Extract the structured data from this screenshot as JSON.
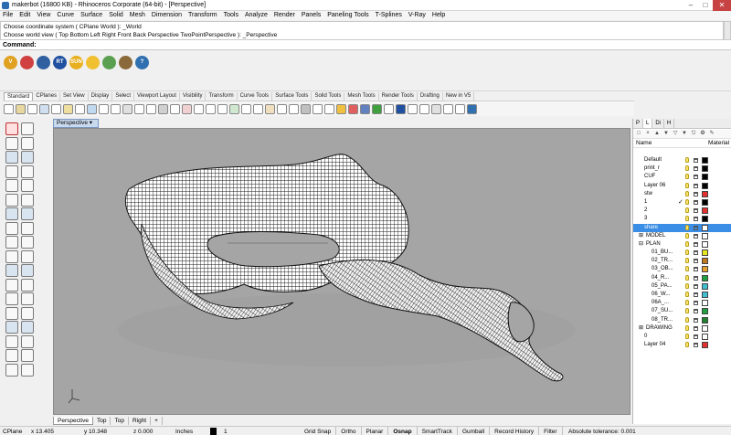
{
  "window": {
    "title": "makerbot (16800 KB) - Rhinoceros Corporate (64-bit) - [Perspective]",
    "controls": [
      "–",
      "□",
      "✕"
    ]
  },
  "menu": [
    "File",
    "Edit",
    "View",
    "Curve",
    "Surface",
    "Solid",
    "Mesh",
    "Dimension",
    "Transform",
    "Tools",
    "Analyze",
    "Render",
    "Panels",
    "Paneling Tools",
    "T-Splines",
    "V-Ray",
    "Help"
  ],
  "command_history": [
    "Choose coordinate system ( CPlane  World ): _World",
    "Choose world view ( Top  Bottom  Left  Right  Front  Back  Perspective  TwoPointPerspective ): _Perspective"
  ],
  "command_prompt": "Command:",
  "plugin_toolbar": [
    {
      "icon": "v-icon",
      "label": "V",
      "color": "#e0a020"
    },
    {
      "icon": "render-icon",
      "label": "",
      "color": "#d04040"
    },
    {
      "icon": "camera-icon",
      "label": "",
      "color": "#3060a0"
    },
    {
      "icon": "rt-icon",
      "label": "RT",
      "color": "#2050a0"
    },
    {
      "icon": "sun-icon",
      "label": "SUN",
      "color": "#e8b020"
    },
    {
      "icon": "light-icon",
      "label": "",
      "color": "#f0c030"
    },
    {
      "icon": "material-icon",
      "label": "",
      "color": "#5aa050"
    },
    {
      "icon": "frame-icon",
      "label": "",
      "color": "#8a6a3a"
    },
    {
      "icon": "help-icon",
      "label": "?",
      "color": "#3070b0"
    }
  ],
  "toolbar_tabs": [
    "Standard",
    "CPlanes",
    "Set View",
    "Display",
    "Select",
    "Viewport Layout",
    "Visibility",
    "Transform",
    "Curve Tools",
    "Surface Tools",
    "Solid Tools",
    "Mesh Tools",
    "Render Tools",
    "Drafting",
    "New in V5"
  ],
  "viewport": {
    "title": "Perspective",
    "dropdown": "▾"
  },
  "viewport_tabs": [
    "Perspective",
    "Top",
    "Top",
    "Right",
    "+"
  ],
  "right_panel": {
    "tabs": [
      "P",
      "L",
      "Di",
      "H"
    ],
    "toolbar": [
      "□",
      "×",
      "▲",
      "▼",
      "▽",
      "▼",
      "⎋",
      "❂",
      "✎"
    ],
    "columns": {
      "name": "Name",
      "material": "Material"
    },
    "layers": [
      {
        "name": "Default",
        "indent": 0,
        "tree": "",
        "color": "#000000",
        "current": false,
        "selected": false
      },
      {
        "name": "print_r",
        "indent": 0,
        "tree": "",
        "color": "#000000",
        "current": false,
        "selected": false
      },
      {
        "name": "CUF",
        "indent": 0,
        "tree": "",
        "color": "#000000",
        "current": false,
        "selected": false
      },
      {
        "name": "Layer 06",
        "indent": 0,
        "tree": "",
        "color": "#000000",
        "current": false,
        "selected": false
      },
      {
        "name": "stw",
        "indent": 0,
        "tree": "",
        "color": "#e53030",
        "current": false,
        "selected": false
      },
      {
        "name": "1",
        "indent": 0,
        "tree": "",
        "color": "#000000",
        "current": true,
        "selected": false
      },
      {
        "name": "2",
        "indent": 0,
        "tree": "",
        "color": "#e53030",
        "current": false,
        "selected": false
      },
      {
        "name": "3",
        "indent": 0,
        "tree": "",
        "color": "#000000",
        "current": false,
        "selected": false
      },
      {
        "name": "share",
        "indent": 0,
        "tree": "",
        "color": "#ffffff",
        "current": false,
        "selected": true
      },
      {
        "name": "MODEL",
        "indent": 0,
        "tree": "⊞",
        "color": "#ffffff",
        "current": false,
        "selected": false
      },
      {
        "name": "PLAN",
        "indent": 0,
        "tree": "⊟",
        "color": "#ffffff",
        "current": false,
        "selected": false
      },
      {
        "name": "01_BU...",
        "indent": 1,
        "tree": "",
        "color": "#e5e520",
        "current": false,
        "selected": false
      },
      {
        "name": "02_TR...",
        "indent": 1,
        "tree": "",
        "color": "#c07820",
        "current": false,
        "selected": false
      },
      {
        "name": "03_OB...",
        "indent": 1,
        "tree": "",
        "color": "#e5a030",
        "current": false,
        "selected": false
      },
      {
        "name": "04_R...",
        "indent": 1,
        "tree": "",
        "color": "#20a040",
        "current": false,
        "selected": false
      },
      {
        "name": "05_PA...",
        "indent": 1,
        "tree": "",
        "color": "#40c0d0",
        "current": false,
        "selected": false
      },
      {
        "name": "06_W...",
        "indent": 1,
        "tree": "",
        "color": "#40c0d0",
        "current": false,
        "selected": false
      },
      {
        "name": "06A_...",
        "indent": 1,
        "tree": "",
        "color": "#ffffff",
        "current": false,
        "selected": false
      },
      {
        "name": "07_SU...",
        "indent": 1,
        "tree": "",
        "color": "#20a040",
        "current": false,
        "selected": false
      },
      {
        "name": "08_TR...",
        "indent": 1,
        "tree": "",
        "color": "#208030",
        "current": false,
        "selected": false
      },
      {
        "name": "DRAWING",
        "indent": 0,
        "tree": "⊞",
        "color": "#ffffff",
        "current": false,
        "selected": false
      },
      {
        "name": "0",
        "indent": 0,
        "tree": "",
        "color": "#ffffff",
        "current": false,
        "selected": false
      },
      {
        "name": "Layer 04",
        "indent": 0,
        "tree": "",
        "color": "#e53030",
        "current": false,
        "selected": false
      }
    ]
  },
  "status": {
    "cplane": "CPlane",
    "x": "x 13.405",
    "y": "y 10.348",
    "z": "z 0.000",
    "units": "Inches",
    "layer_name": "1",
    "toggles": [
      "Grid Snap",
      "Ortho",
      "Planar",
      "Osnap",
      "SmartTrack",
      "Gumball",
      "Record History",
      "Filter"
    ],
    "tolerance": "Absolute tolerance: 0.001"
  }
}
